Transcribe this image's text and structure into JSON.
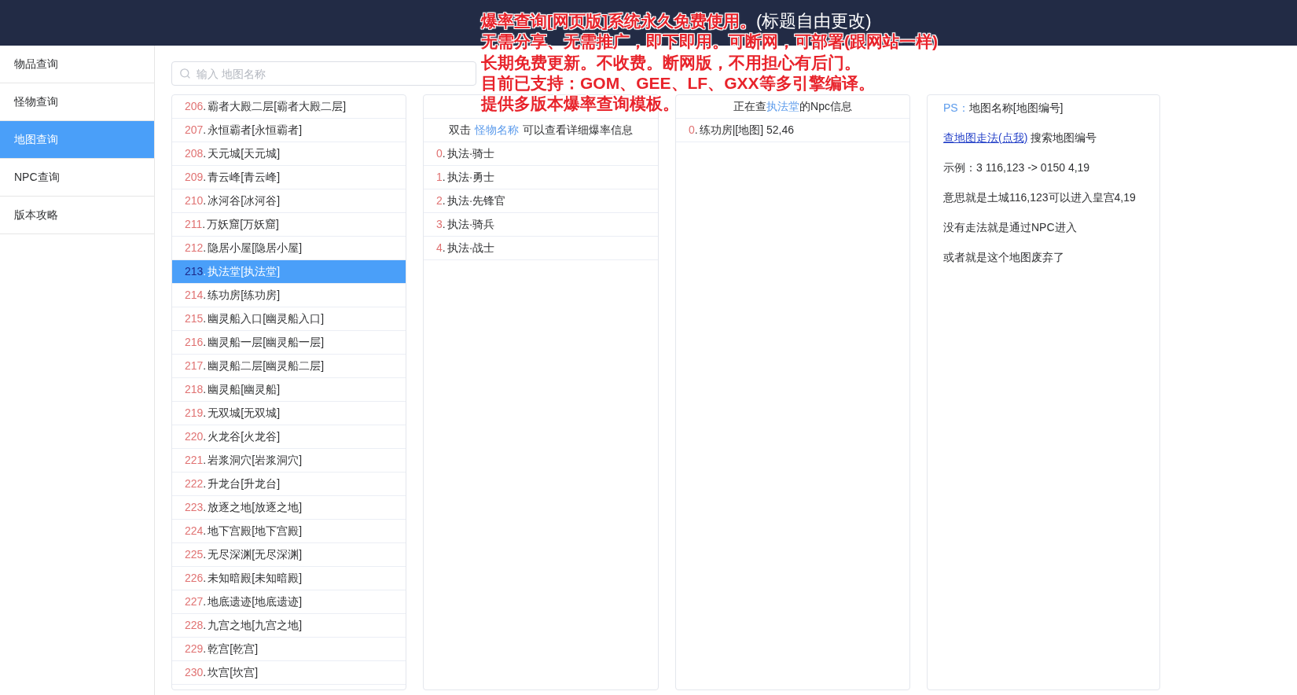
{
  "header": {
    "title": "(标题自由更改)"
  },
  "annotation": {
    "lines": [
      "爆率查询[网页版]系统永久免费使用。",
      "无需分享、无需推广，即下即用。可断网，可部署(跟网站一样)",
      "长期免费更新。不收费。断网版，不用担心有后门。",
      "目前已支持：GOM、GEE、LF、GXX等多引擎编译。",
      "提供多版本爆率查询模板。"
    ]
  },
  "sidebar": {
    "items": [
      {
        "label": "物品查询",
        "selected": false
      },
      {
        "label": "怪物查询",
        "selected": false
      },
      {
        "label": "地图查询",
        "selected": true
      },
      {
        "label": "NPC查询",
        "selected": false
      },
      {
        "label": "版本攻略",
        "selected": false
      }
    ]
  },
  "search": {
    "placeholder": "输入 地图名称"
  },
  "map_list": {
    "items": [
      {
        "number": "206",
        "separator": ".",
        "name": "霸者大殿二层[霸者大殿二层]",
        "selected": false
      },
      {
        "number": "207",
        "separator": ".",
        "name": "永恒霸者[永恒霸者]",
        "selected": false
      },
      {
        "number": "208",
        "separator": ".",
        "name": "天元城[天元城]",
        "selected": false
      },
      {
        "number": "209",
        "separator": ".",
        "name": "青云峰[青云峰]",
        "selected": false
      },
      {
        "number": "210",
        "separator": ".",
        "name": "冰河谷[冰河谷]",
        "selected": false
      },
      {
        "number": "211",
        "separator": ".",
        "name": "万妖窟[万妖窟]",
        "selected": false
      },
      {
        "number": "212",
        "separator": ".",
        "name": "隐居小屋[隐居小屋]",
        "selected": false
      },
      {
        "number": "213",
        "separator": ".",
        "name": "执法堂[执法堂]",
        "selected": true
      },
      {
        "number": "214",
        "separator": ".",
        "name": "练功房[练功房]",
        "selected": false
      },
      {
        "number": "215",
        "separator": ".",
        "name": "幽灵船入口[幽灵船入口]",
        "selected": false
      },
      {
        "number": "216",
        "separator": ".",
        "name": "幽灵船一层[幽灵船一层]",
        "selected": false
      },
      {
        "number": "217",
        "separator": ".",
        "name": "幽灵船二层[幽灵船二层]",
        "selected": false
      },
      {
        "number": "218",
        "separator": ".",
        "name": "幽灵船[幽灵船]",
        "selected": false
      },
      {
        "number": "219",
        "separator": ".",
        "name": "无双城[无双城]",
        "selected": false
      },
      {
        "number": "220",
        "separator": ".",
        "name": "火龙谷[火龙谷]",
        "selected": false
      },
      {
        "number": "221",
        "separator": ".",
        "name": "岩浆洞穴[岩浆洞穴]",
        "selected": false
      },
      {
        "number": "222",
        "separator": ".",
        "name": "升龙台[升龙台]",
        "selected": false
      },
      {
        "number": "223",
        "separator": ".",
        "name": "放逐之地[放逐之地]",
        "selected": false
      },
      {
        "number": "224",
        "separator": ".",
        "name": "地下宫殿[地下宫殿]",
        "selected": false
      },
      {
        "number": "225",
        "separator": ".",
        "name": "无尽深渊[无尽深渊]",
        "selected": false
      },
      {
        "number": "226",
        "separator": ".",
        "name": "未知暗殿[未知暗殿]",
        "selected": false
      },
      {
        "number": "227",
        "separator": ".",
        "name": "地底遗迹[地底遗迹]",
        "selected": false
      },
      {
        "number": "228",
        "separator": ".",
        "name": "九宫之地[九宫之地]",
        "selected": false
      },
      {
        "number": "229",
        "separator": ".",
        "name": "乾宫[乾宫]",
        "selected": false
      },
      {
        "number": "230",
        "separator": ".",
        "name": "坎宫[坎宫]",
        "selected": false
      }
    ]
  },
  "monster_panel": {
    "instruction": {
      "before": "双击",
      "highlight": "怪物名称",
      "after": "可以查看详细爆率信息"
    },
    "items": [
      {
        "number": "0",
        "separator": ".",
        "name": "执法·骑士"
      },
      {
        "number": "1",
        "separator": ".",
        "name": "执法·勇士"
      },
      {
        "number": "2",
        "separator": ".",
        "name": "执法·先锋官"
      },
      {
        "number": "3",
        "separator": ".",
        "name": "执法·骑兵"
      },
      {
        "number": "4",
        "separator": ".",
        "name": "执法·战士"
      }
    ]
  },
  "npc_panel": {
    "heading": {
      "before": "正在查",
      "highlight": "执法堂",
      "after": "的Npc信息"
    },
    "items": [
      {
        "number": "0",
        "separator": ".",
        "name": "练功房|[地图] 52,46"
      }
    ]
  },
  "help_panel": {
    "lines": [
      {
        "kind": "ps",
        "label": "PS：",
        "text": "地图名称[地图编号]"
      },
      {
        "kind": "link",
        "link": "查地图走法(点我)",
        "text": "搜索地图编号"
      },
      {
        "kind": "text",
        "text": "示例：3 116,123 -> 0150 4,19"
      },
      {
        "kind": "text",
        "text": "意思就是土城116,123可以进入皇宫4,19"
      },
      {
        "kind": "text",
        "text": "没有走法就是通过NPC进入"
      },
      {
        "kind": "text",
        "text": "或者就是这个地图废弃了"
      }
    ]
  }
}
